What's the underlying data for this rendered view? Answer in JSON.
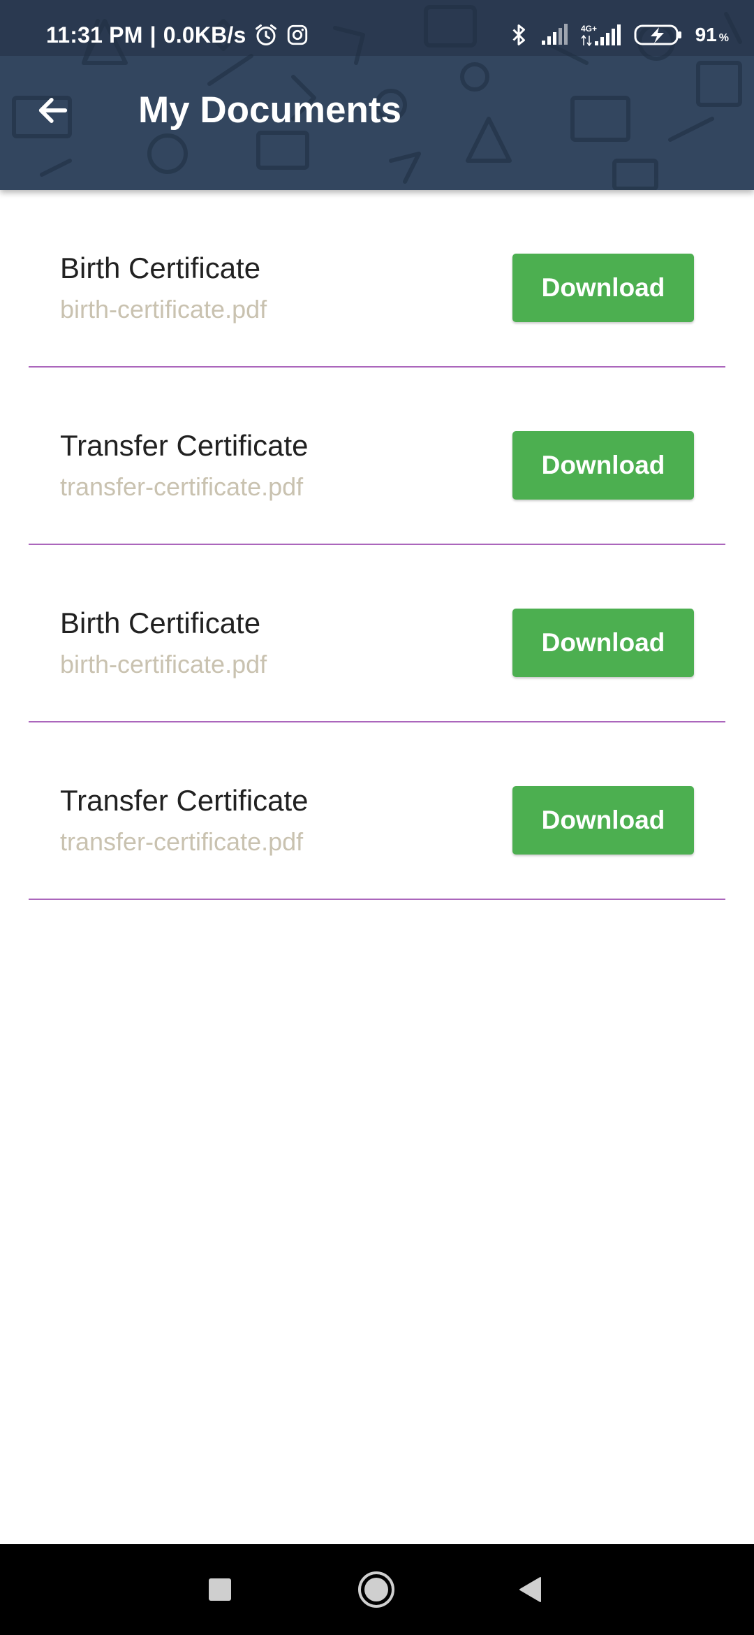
{
  "status_bar": {
    "time": "11:31 PM",
    "separator": "|",
    "net_speed": "0.0KB/s",
    "icons_left": [
      "alarm-icon",
      "instagram-icon"
    ],
    "icons_right": [
      "bluetooth-icon",
      "signal-icon",
      "signal-4g-icon",
      "battery-charging-icon"
    ],
    "network_type": "4G+",
    "battery_level": "91",
    "battery_unit": "%"
  },
  "app_bar": {
    "back_icon": "arrow-left-icon",
    "title": "My Documents",
    "background_color": "#33465f"
  },
  "documents": [
    {
      "title": "Birth Certificate",
      "filename": "birth-certificate.pdf",
      "button_label": "Download"
    },
    {
      "title": "Transfer Certificate",
      "filename": "transfer-certificate.pdf",
      "button_label": "Download"
    },
    {
      "title": "Birth Certificate",
      "filename": "birth-certificate.pdf",
      "button_label": "Download"
    },
    {
      "title": "Transfer Certificate",
      "filename": "transfer-certificate.pdf",
      "button_label": "Download"
    }
  ],
  "colors": {
    "accent_button": "#4caf50",
    "divider": "#9c4bb0",
    "filename_text": "#c9c2b0"
  },
  "nav_bar": {
    "buttons": [
      "recents-square-icon",
      "home-circle-icon",
      "back-triangle-icon"
    ]
  }
}
